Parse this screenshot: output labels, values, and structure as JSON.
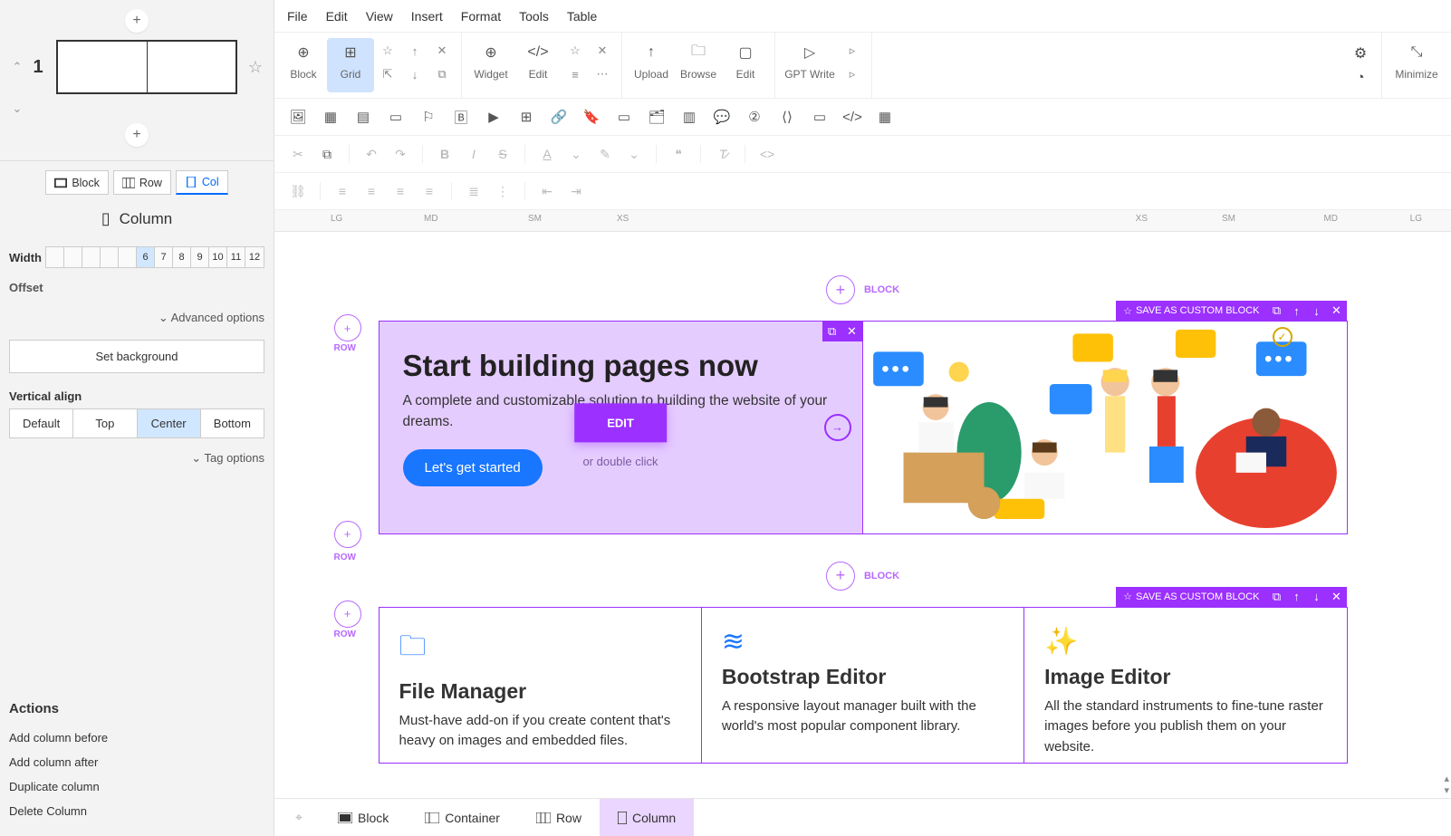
{
  "menu": {
    "file": "File",
    "edit": "Edit",
    "view": "View",
    "insert": "Insert",
    "format": "Format",
    "tools": "Tools",
    "table": "Table"
  },
  "toolbar": {
    "block": "Block",
    "grid": "Grid",
    "widget": "Widget",
    "edit": "Edit",
    "upload": "Upload",
    "browse": "Browse",
    "edit2": "Edit",
    "gptwrite": "GPT Write",
    "minimize": "Minimize"
  },
  "scope": {
    "block": "Block",
    "row": "Row",
    "col": "Col"
  },
  "panel": {
    "title": "Column",
    "width_label": "Width",
    "widths": [
      "",
      "",
      "",
      "",
      "",
      "6",
      "7",
      "8",
      "9",
      "10",
      "11",
      "12"
    ],
    "width_selected": 5,
    "offset_label": "Offset",
    "advanced": "Advanced options",
    "set_bg": "Set background",
    "va_title": "Vertical align",
    "va": [
      "Default",
      "Top",
      "Center",
      "Bottom"
    ],
    "va_selected": 2,
    "tag_opts": "Tag options",
    "actions_title": "Actions",
    "actions": [
      "Add column before",
      "Add column after",
      "Duplicate column",
      "Delete Column"
    ]
  },
  "slide": {
    "num": "1"
  },
  "ruler": {
    "bps_left": [
      "LG",
      "MD",
      "SM",
      "XS"
    ],
    "bps_right": [
      "XS",
      "SM",
      "MD",
      "LG"
    ]
  },
  "canvas": {
    "add_block": "BLOCK",
    "row_label": "ROW",
    "save_custom": "SAVE AS CUSTOM BLOCK",
    "edit_btn": "EDIT",
    "edit_sub": "or double click",
    "hero": {
      "title": "Start building pages now",
      "sub": "A complete and customizable solution to building the website of your dreams.",
      "cta": "Let's get started"
    },
    "features": [
      {
        "title": "File Manager",
        "desc": "Must-have add-on if you create content  that's heavy on images and embedded files."
      },
      {
        "title": "Bootstrap Editor",
        "desc": "A responsive layout manager built with the world's most popular component library."
      },
      {
        "title": "Image Editor",
        "desc": "All the standard instruments to fine-tune raster images before you publish them on your website."
      }
    ]
  },
  "breadcrumb": {
    "block": "Block",
    "container": "Container",
    "row": "Row",
    "column": "Column"
  }
}
